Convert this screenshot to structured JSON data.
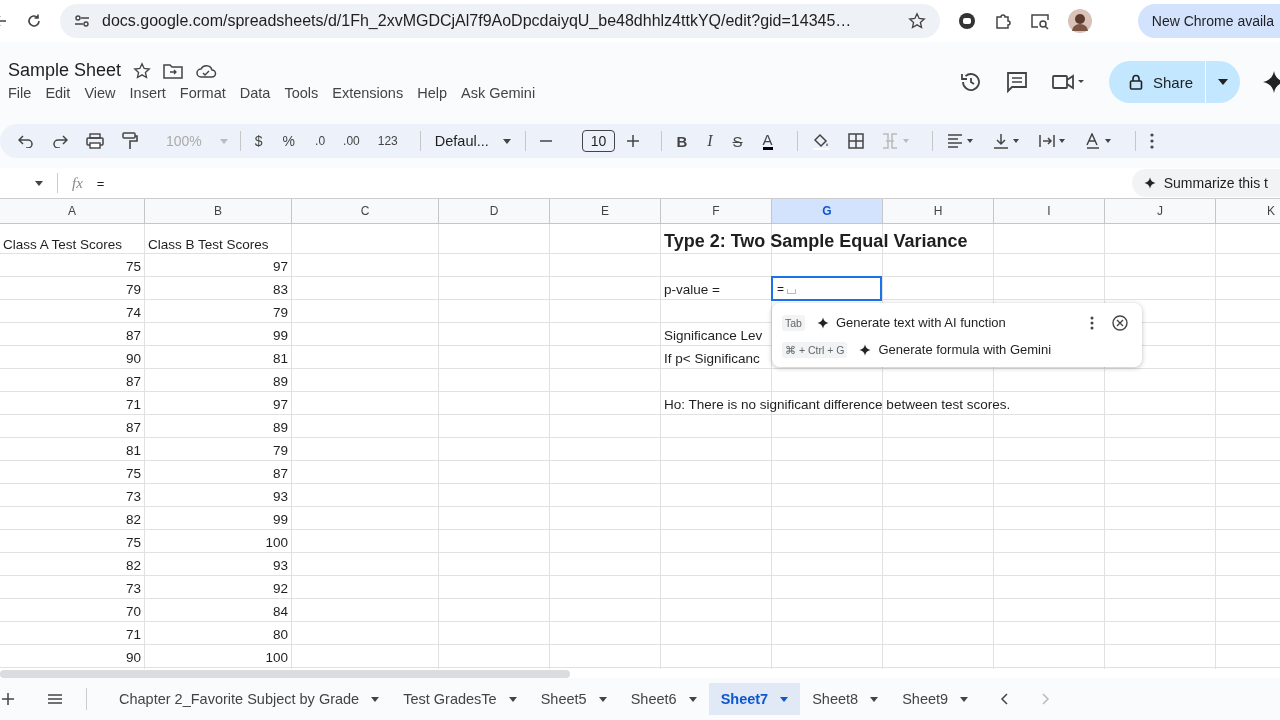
{
  "browser": {
    "url": "docs.google.com/spreadsheets/d/1Fh_2xvMGDCjAl7f9AoDpcdaiyqU_be48dhhlz4ttkYQ/edit?gid=14345…",
    "update_label": "New Chrome availa"
  },
  "doc": {
    "title": "Sample Sheet",
    "share": "Share"
  },
  "menu": [
    "File",
    "Edit",
    "View",
    "Insert",
    "Format",
    "Data",
    "Tools",
    "Extensions",
    "Help",
    "Ask Gemini"
  ],
  "toolbar": {
    "zoom": "100%",
    "currency": "$",
    "percent": "%",
    "decrease_decimals": ".0",
    "increase_decimals": ".00",
    "more_formats": "123",
    "font": "Defaul...",
    "font_size": "10",
    "bold": "B",
    "italic": "I",
    "strikethrough": "S",
    "text_color": "A"
  },
  "formula_bar": {
    "function_label": "fx",
    "value": "=",
    "summarize": "Summarize this t"
  },
  "columns": [
    {
      "letter": "A",
      "selected": false
    },
    {
      "letter": "B",
      "selected": false
    },
    {
      "letter": "C",
      "selected": false
    },
    {
      "letter": "D",
      "selected": false
    },
    {
      "letter": "E",
      "selected": false
    },
    {
      "letter": "F",
      "selected": false
    },
    {
      "letter": "G",
      "selected": true
    },
    {
      "letter": "H",
      "selected": false
    },
    {
      "letter": "I",
      "selected": false
    },
    {
      "letter": "J",
      "selected": false
    },
    {
      "letter": "K",
      "selected": false
    }
  ],
  "rows": [
    {
      "A": {
        "text": "Class A Test Scores",
        "kind": "text"
      },
      "B": {
        "text": "Class B Test Scores",
        "kind": "text"
      },
      "F": {
        "text": "Type 2: Two Sample Equal Variance",
        "kind": "heading"
      }
    },
    {
      "A": {
        "text": "75",
        "kind": "number"
      },
      "B": {
        "text": "97",
        "kind": "number"
      }
    },
    {
      "A": {
        "text": "79",
        "kind": "number"
      },
      "B": {
        "text": "83",
        "kind": "number"
      },
      "F": {
        "text": "p-value =",
        "kind": "text"
      },
      "G": {
        "text": "=",
        "kind": "editing"
      }
    },
    {
      "A": {
        "text": "74",
        "kind": "number"
      },
      "B": {
        "text": "79",
        "kind": "number"
      }
    },
    {
      "A": {
        "text": "87",
        "kind": "number"
      },
      "B": {
        "text": "99",
        "kind": "number"
      },
      "F": {
        "text": "Significance Lev",
        "kind": "text"
      }
    },
    {
      "A": {
        "text": "90",
        "kind": "number"
      },
      "B": {
        "text": "81",
        "kind": "number"
      },
      "F": {
        "text": "If p< Significanc",
        "kind": "text"
      }
    },
    {
      "A": {
        "text": "87",
        "kind": "number"
      },
      "B": {
        "text": "89",
        "kind": "number"
      }
    },
    {
      "A": {
        "text": "71",
        "kind": "number"
      },
      "B": {
        "text": "97",
        "kind": "number"
      },
      "F": {
        "text": "Ho: There is no significant difference between test scores.",
        "kind": "text"
      }
    },
    {
      "A": {
        "text": "87",
        "kind": "number"
      },
      "B": {
        "text": "89",
        "kind": "number"
      }
    },
    {
      "A": {
        "text": "81",
        "kind": "number"
      },
      "B": {
        "text": "79",
        "kind": "number"
      }
    },
    {
      "A": {
        "text": "75",
        "kind": "number"
      },
      "B": {
        "text": "87",
        "kind": "number"
      }
    },
    {
      "A": {
        "text": "73",
        "kind": "number"
      },
      "B": {
        "text": "93",
        "kind": "number"
      }
    },
    {
      "A": {
        "text": "82",
        "kind": "number"
      },
      "B": {
        "text": "99",
        "kind": "number"
      }
    },
    {
      "A": {
        "text": "75",
        "kind": "number"
      },
      "B": {
        "text": "100",
        "kind": "number"
      }
    },
    {
      "A": {
        "text": "82",
        "kind": "number"
      },
      "B": {
        "text": "93",
        "kind": "number"
      }
    },
    {
      "A": {
        "text": "73",
        "kind": "number"
      },
      "B": {
        "text": "92",
        "kind": "number"
      }
    },
    {
      "A": {
        "text": "70",
        "kind": "number"
      },
      "B": {
        "text": "84",
        "kind": "number"
      }
    },
    {
      "A": {
        "text": "71",
        "kind": "number"
      },
      "B": {
        "text": "80",
        "kind": "number"
      }
    },
    {
      "A": {
        "text": "90",
        "kind": "number"
      },
      "B": {
        "text": "100",
        "kind": "number"
      }
    }
  ],
  "suggestions": [
    {
      "shortcut": "Tab",
      "label": "Generate text with AI function"
    },
    {
      "shortcut": "⌘ + Ctrl + G",
      "label": "Generate formula with Gemini"
    }
  ],
  "sheet_tabs": [
    {
      "label": "Chapter 2_Favorite Subject by Grade",
      "selected": false
    },
    {
      "label": "Test GradesTe",
      "selected": false
    },
    {
      "label": "Sheet5",
      "selected": false
    },
    {
      "label": "Sheet6",
      "selected": false
    },
    {
      "label": "Sheet7",
      "selected": true
    },
    {
      "label": "Sheet8",
      "selected": false
    },
    {
      "label": "Sheet9",
      "selected": false
    }
  ]
}
